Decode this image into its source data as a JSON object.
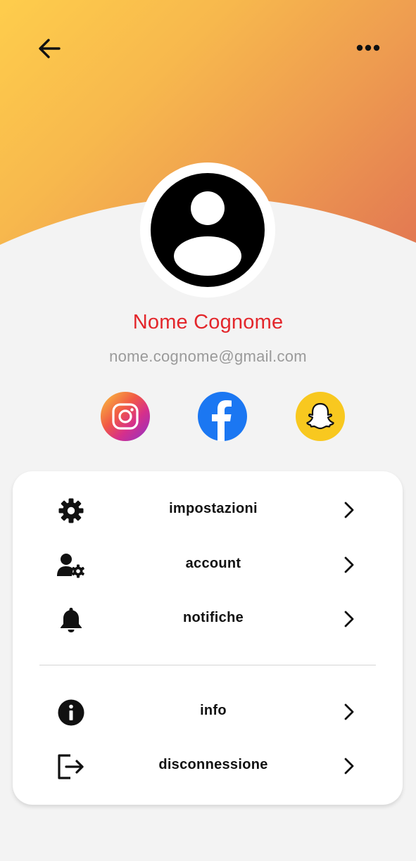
{
  "header": {
    "back_icon": "arrow-left-icon",
    "more_icon": "more-horizontal-icon",
    "gradient_colors": [
      "#fecd4c",
      "#ee9c50",
      "#e27752"
    ]
  },
  "profile": {
    "avatar_icon": "user-avatar-icon",
    "name": "Nome Cognome",
    "email": "nome.cognome@gmail.com",
    "name_color": "#e3262b"
  },
  "social": [
    {
      "icon": "instagram-icon",
      "color": "#d62f8b"
    },
    {
      "icon": "facebook-icon",
      "color": "#1b77f2"
    },
    {
      "icon": "snapchat-icon",
      "color": "#f8c81f"
    }
  ],
  "menu": {
    "items": [
      {
        "label": "impostazioni",
        "icon": "gear-icon"
      },
      {
        "label": "account",
        "icon": "user-settings-icon"
      },
      {
        "label": "notifiche",
        "icon": "bell-icon"
      },
      {
        "label": "info",
        "icon": "info-icon"
      },
      {
        "label": "disconnessione",
        "icon": "logout-icon"
      }
    ],
    "chevron_icon": "chevron-right-icon"
  }
}
